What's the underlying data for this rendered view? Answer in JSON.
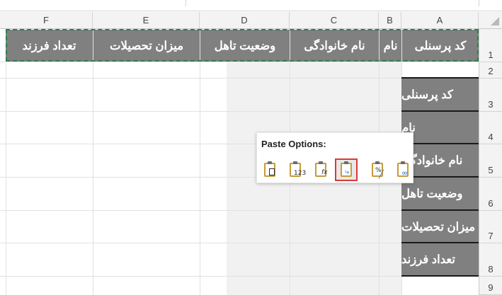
{
  "columns": [
    "F",
    "E",
    "D",
    "C",
    "B",
    "A"
  ],
  "rows": [
    "1",
    "2",
    "3",
    "4",
    "5",
    "6",
    "7",
    "8",
    "9"
  ],
  "row1_headers": [
    "تعداد فرزند",
    "میزان تحصیلات",
    "وضعیت تاهل",
    "نام خانوادگی",
    "نام",
    "کد پرسنلی"
  ],
  "column_a_values": [
    "کد پرسنلی",
    "نام",
    "نام خانوادگی",
    "وضعیت تاهل",
    "میزان تحصیلات",
    "تعداد فرزند"
  ],
  "paste_options": {
    "title": "Paste Options:",
    "icons": [
      {
        "name": "paste-icon",
        "badge": ""
      },
      {
        "name": "paste-values-icon",
        "badge": "123"
      },
      {
        "name": "paste-formulas-icon",
        "badge": "fx"
      },
      {
        "name": "paste-transpose-icon",
        "badge": "",
        "selected": true
      },
      {
        "name": "paste-formatting-icon",
        "badge": "%"
      },
      {
        "name": "paste-link-icon",
        "badge": ""
      }
    ]
  },
  "colors": {
    "header_fill": "#808080",
    "marquee": "#2e7d4f",
    "selected_outline": "#d93a3a"
  }
}
